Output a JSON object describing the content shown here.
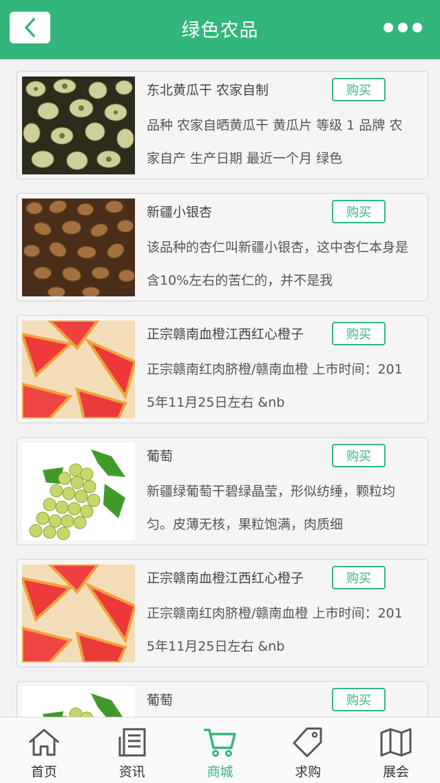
{
  "header": {
    "title": "绿色农品"
  },
  "products": [
    {
      "name": "东北黄瓜干 农家自制",
      "buy_label": "购买",
      "desc": "品种 农家自晒黄瓜干 黄瓜片 等级 1 品牌 农家自产 生产日期 最近一个月 绿色",
      "image": "dried-cucumber"
    },
    {
      "name": "新疆小银杏",
      "buy_label": "购买",
      "desc": "该品种的杏仁叫新疆小银杏，这中杏仁本身是含10%左右的苦仁的，并不是我",
      "image": "apricot-kernels"
    },
    {
      "name": "正宗赣南血橙江西红心橙子",
      "buy_label": "购买",
      "desc": "正宗赣南红肉脐橙/赣南血橙 上市时间：2015年11月25日左右 &nb",
      "image": "blood-orange"
    },
    {
      "name": "葡萄",
      "buy_label": "购买",
      "desc": "新疆绿葡萄干碧绿晶莹，形似纺缍，颗粒均匀。皮薄无核，果粒饱满，肉质细",
      "image": "green-grapes"
    },
    {
      "name": "正宗赣南血橙江西红心橙子",
      "buy_label": "购买",
      "desc": "正宗赣南红肉脐橙/赣南血橙 上市时间：2015年11月25日左右 &nb",
      "image": "blood-orange"
    },
    {
      "name": "葡萄",
      "buy_label": "购买",
      "desc": "",
      "image": "green-grapes"
    }
  ],
  "tabbar": [
    {
      "label": "首页",
      "icon": "home-icon"
    },
    {
      "label": "资讯",
      "icon": "news-icon"
    },
    {
      "label": "商城",
      "icon": "cart-icon",
      "active": true
    },
    {
      "label": "求购",
      "icon": "tag-icon"
    },
    {
      "label": "展会",
      "icon": "map-icon"
    }
  ],
  "colors": {
    "accent": "#33b67c",
    "background": "#f2f2f2"
  }
}
